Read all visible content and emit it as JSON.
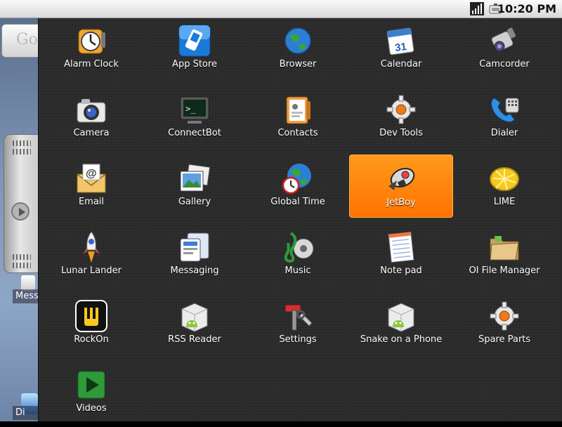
{
  "status_bar": {
    "time": "10:20 PM",
    "icons": [
      "signal-icon",
      "battery-icon"
    ]
  },
  "home_screen": {
    "search_text": "Go",
    "partial_labels": [
      "Mess",
      "Di"
    ]
  },
  "apps": [
    {
      "label": "Alarm Clock",
      "icon": "alarm-clock-icon"
    },
    {
      "label": "App Store",
      "icon": "app-store-icon"
    },
    {
      "label": "Browser",
      "icon": "globe-icon"
    },
    {
      "label": "Calendar",
      "icon": "calendar-icon",
      "badge": "31"
    },
    {
      "label": "Camcorder",
      "icon": "camcorder-icon"
    },
    {
      "label": "Camera",
      "icon": "camera-icon"
    },
    {
      "label": "ConnectBot",
      "icon": "terminal-icon",
      "badge": ">_"
    },
    {
      "label": "Contacts",
      "icon": "contacts-icon"
    },
    {
      "label": "Dev Tools",
      "icon": "gear-icon"
    },
    {
      "label": "Dialer",
      "icon": "phone-icon"
    },
    {
      "label": "Email",
      "icon": "envelope-icon",
      "badge": "@"
    },
    {
      "label": "Gallery",
      "icon": "photos-icon"
    },
    {
      "label": "Global Time",
      "icon": "globe-clock-icon"
    },
    {
      "label": "JetBoy",
      "icon": "jetboy-icon",
      "selected": true
    },
    {
      "label": "LIME",
      "icon": "lemon-icon"
    },
    {
      "label": "Lunar Lander",
      "icon": "rocket-icon"
    },
    {
      "label": "Messaging",
      "icon": "messaging-icon"
    },
    {
      "label": "Music",
      "icon": "music-icon"
    },
    {
      "label": "Note pad",
      "icon": "notepad-icon"
    },
    {
      "label": "OI File Manager",
      "icon": "folder-icon"
    },
    {
      "label": "RockOn",
      "icon": "rockon-icon"
    },
    {
      "label": "RSS Reader",
      "icon": "android-box-icon"
    },
    {
      "label": "Settings",
      "icon": "settings-tools-icon"
    },
    {
      "label": "Snake on a Phone",
      "icon": "android-box-icon"
    },
    {
      "label": "Spare Parts",
      "icon": "gear-icon"
    },
    {
      "label": "Videos",
      "icon": "play-icon"
    }
  ],
  "colors": {
    "selection": "#ff7a00",
    "drawer_bg": "#2a2a2a"
  }
}
